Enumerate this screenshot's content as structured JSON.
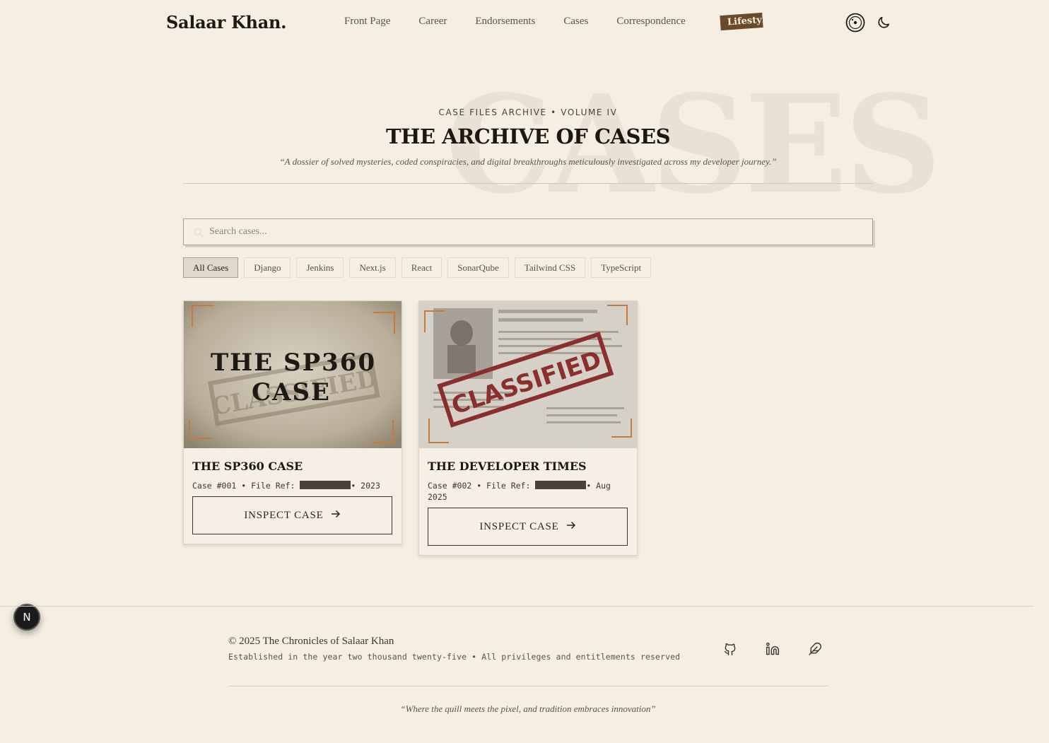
{
  "header": {
    "logo": "Salaar Khan.",
    "nav": [
      "Front Page",
      "Career",
      "Endorsements",
      "Cases",
      "Correspondence"
    ],
    "nav_highlight": "Lifestyl",
    "icons": [
      "record-icon",
      "moon-icon"
    ]
  },
  "hero": {
    "watermark": "CASES",
    "eyebrow": "CASE FILES ARCHIVE • VOLUME IV",
    "title": "THE ARCHIVE OF CASES",
    "subtitle": "“A dossier of solved mysteries, coded conspiracies, and digital breakthroughs meticulously investigated across my developer journey.”"
  },
  "search": {
    "placeholder": "Search cases...",
    "value": ""
  },
  "filters": [
    "All Cases",
    "Django",
    "Jenkins",
    "Next.js",
    "React",
    "SonarQube",
    "Tailwind CSS",
    "TypeScript"
  ],
  "active_filter": "All Cases",
  "cards": [
    {
      "image_text_line1": "THE SP360",
      "image_text_line2": "CASE",
      "stamp": "CLASSIFIED",
      "title": "THE SP360 CASE",
      "case_no": "Case #001 • File Ref: ",
      "date": "• 2023",
      "button": "INSPECT CASE"
    },
    {
      "stamp": "CLASSIFIED",
      "title": "THE DEVELOPER TIMES",
      "case_no": "Case #002 • File Ref: ",
      "date": "• Aug 2025",
      "button": "INSPECT CASE"
    }
  ],
  "floating_badge": "N",
  "footer": {
    "copyright": "© 2025 The Chronicles of Salaar Khan",
    "established": "Established in the year two thousand twenty-five • All privileges and entitlements reserved",
    "social_icons": [
      "github-icon",
      "linkedin-icon",
      "feather-icon"
    ],
    "quote": "“Where the quill meets the pixel, and tradition embraces innovation”"
  },
  "colors": {
    "background": "#f4eee3",
    "accent_brown": "#6b4a2a",
    "stamp_red": "#8b2e2e",
    "corner_orange": "#c87a3a"
  }
}
